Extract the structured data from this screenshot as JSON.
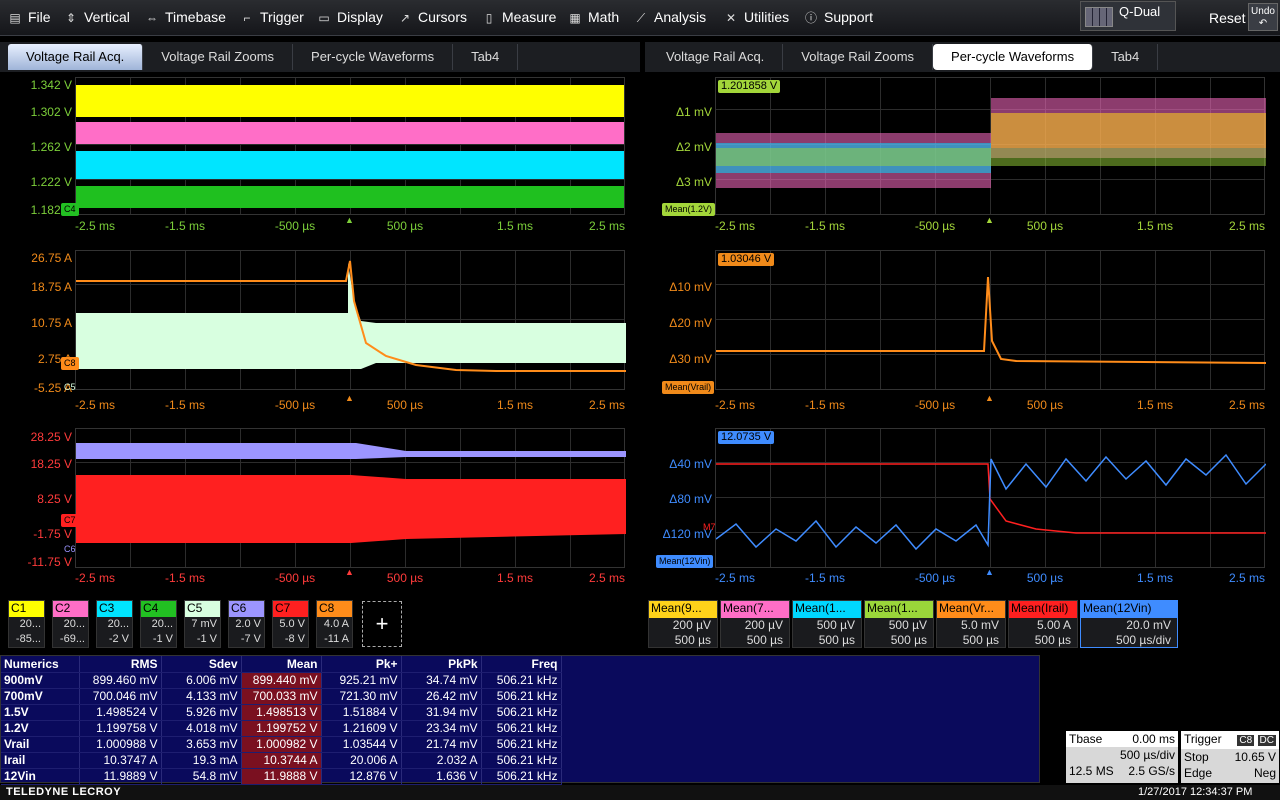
{
  "menu": {
    "file": "File",
    "vertical": "Vertical",
    "timebase": "Timebase",
    "trigger": "Trigger",
    "display": "Display",
    "cursors": "Cursors",
    "measure": "Measure",
    "math": "Math",
    "analysis": "Analysis",
    "utilities": "Utilities",
    "support": "Support",
    "qdual": "Q-Dual",
    "reset": "Reset",
    "undo": "Undo"
  },
  "tabs_left": [
    "Voltage Rail Acq.",
    "Voltage Rail Zooms",
    "Per-cycle Waveforms",
    "Tab4"
  ],
  "tabs_right": [
    "Voltage Rail Acq.",
    "Voltage Rail Zooms",
    "Per-cycle Waveforms",
    "Tab4"
  ],
  "xticks": [
    "-2.5 ms",
    "-1.5 ms",
    "-500 µs",
    "500 µs",
    "1.5 ms",
    "2.5 ms"
  ],
  "plots": {
    "p1": {
      "yticks": [
        "1.342 V",
        "1.302 V",
        "1.262 V",
        "1.222 V",
        "1.182 V"
      ],
      "marker": "C4",
      "color": "#7ccf3a"
    },
    "p2": {
      "yticks": [
        "26.75 A",
        "18.75 A",
        "10.75 A",
        "2.75 A",
        "-5.25 A"
      ],
      "marker": "C8",
      "marker2": "C5",
      "color": "#f08a1a"
    },
    "p3": {
      "yticks": [
        "28.25 V",
        "18.25 V",
        "8.25 V",
        "-1.75 V",
        "-11.75 V"
      ],
      "marker": "C7",
      "marker2": "C6",
      "color": "#ff3b3b"
    },
    "p4": {
      "yticks": [
        "Δ1 mV",
        "Δ2 mV",
        "Δ3 mV"
      ],
      "value": "1.201858 V",
      "tag": "Mean(1.2V)",
      "color": "#a3d63a"
    },
    "p5": {
      "yticks": [
        "Δ10 mV",
        "Δ20 mV",
        "Δ30 mV"
      ],
      "value": "1.03046 V",
      "tag": "Mean(Vrail)",
      "color": "#f08a1a"
    },
    "p6": {
      "yticks": [
        "Δ40 mV",
        "Δ80 mV",
        "Δ120 mV"
      ],
      "value": "12.0735 V",
      "tag": "Mean(12Vin)",
      "color": "#3f8cff",
      "marker": "M7"
    }
  },
  "channels": [
    {
      "name": "C1",
      "color": "#ffff00",
      "v1": "20...",
      "v2": "-85..."
    },
    {
      "name": "C2",
      "color": "#ff6ec7",
      "v1": "20...",
      "v2": "-69..."
    },
    {
      "name": "C3",
      "color": "#00e5ff",
      "v1": "20...",
      "v2": "-2 V"
    },
    {
      "name": "C4",
      "color": "#22c022",
      "v1": "20...",
      "v2": "-1 V"
    },
    {
      "name": "C5",
      "color": "#d8ffe0",
      "v1": "7 mV",
      "v2": "-1 V"
    },
    {
      "name": "C6",
      "color": "#9c95ff",
      "v1": "2.0 V",
      "v2": "-7 V"
    },
    {
      "name": "C7",
      "color": "#ff2020",
      "v1": "5.0 V",
      "v2": "-8 V"
    },
    {
      "name": "C8",
      "color": "#ff8c1a",
      "v1": "4.0 A",
      "v2": "-11 A"
    }
  ],
  "add_label": "+",
  "math": [
    {
      "name": "Mean(9...",
      "color": "#ffd21a",
      "v1": "200 µV",
      "v2": "500 µs"
    },
    {
      "name": "Mean(7...",
      "color": "#ff6ec7",
      "v1": "200 µV",
      "v2": "500 µs"
    },
    {
      "name": "Mean(1...",
      "color": "#00d7ff",
      "v1": "500 µV",
      "v2": "500 µs"
    },
    {
      "name": "Mean(1...",
      "color": "#9ad63a",
      "v1": "500 µV",
      "v2": "500 µs"
    },
    {
      "name": "Mean(Vr...",
      "color": "#ff8c1a",
      "v1": "5.0 mV",
      "v2": "500 µs"
    },
    {
      "name": "Mean(Irail)",
      "color": "#ff2020",
      "v1": "5.00 A",
      "v2": "500 µs"
    },
    {
      "name": "Mean(12Vin)",
      "color": "#3f8cff",
      "v1": "20.0 mV",
      "v2": "500 µs/div"
    }
  ],
  "numerics": {
    "headers": [
      "Numerics",
      "RMS",
      "Sdev",
      "Mean",
      "Pk+",
      "PkPk",
      "Freq"
    ],
    "rows": [
      [
        "900mV",
        "899.460 mV",
        "6.006 mV",
        "899.440 mV",
        "925.21 mV",
        "34.74 mV",
        "506.21 kHz"
      ],
      [
        "700mV",
        "700.046 mV",
        "4.133 mV",
        "700.033 mV",
        "721.30 mV",
        "26.42 mV",
        "506.21 kHz"
      ],
      [
        "1.5V",
        "1.498524 V",
        "5.926 mV",
        "1.498513 V",
        "1.51884 V",
        "31.94 mV",
        "506.21 kHz"
      ],
      [
        "1.2V",
        "1.199758 V",
        "4.018 mV",
        "1.199752 V",
        "1.21609 V",
        "23.34 mV",
        "506.21 kHz"
      ],
      [
        "Vrail",
        "1.000988 V",
        "3.653 mV",
        "1.000982 V",
        "1.03544 V",
        "21.74 mV",
        "506.21 kHz"
      ],
      [
        "Irail",
        "10.3747 A",
        "19.3 mA",
        "10.3744 A",
        "20.006 A",
        "2.032 A",
        "506.21 kHz"
      ],
      [
        "12Vin",
        "11.9889 V",
        "54.8 mV",
        "11.9888 V",
        "12.876 V",
        "1.636 V",
        "506.21 kHz"
      ]
    ]
  },
  "timebase": {
    "label": "Tbase",
    "offset": "0.00 ms",
    "div": "500 µs/div",
    "samples": "12.5 MS",
    "rate": "2.5 GS/s"
  },
  "trigger": {
    "label": "Trigger",
    "src": "C8",
    "coupling": "DC",
    "mode": "Stop",
    "level": "10.65 V",
    "type": "Edge",
    "slope": "Neg"
  },
  "status": {
    "brand": "TELEDYNE LECROY",
    "datetime": "1/27/2017 12:34:37 PM"
  }
}
